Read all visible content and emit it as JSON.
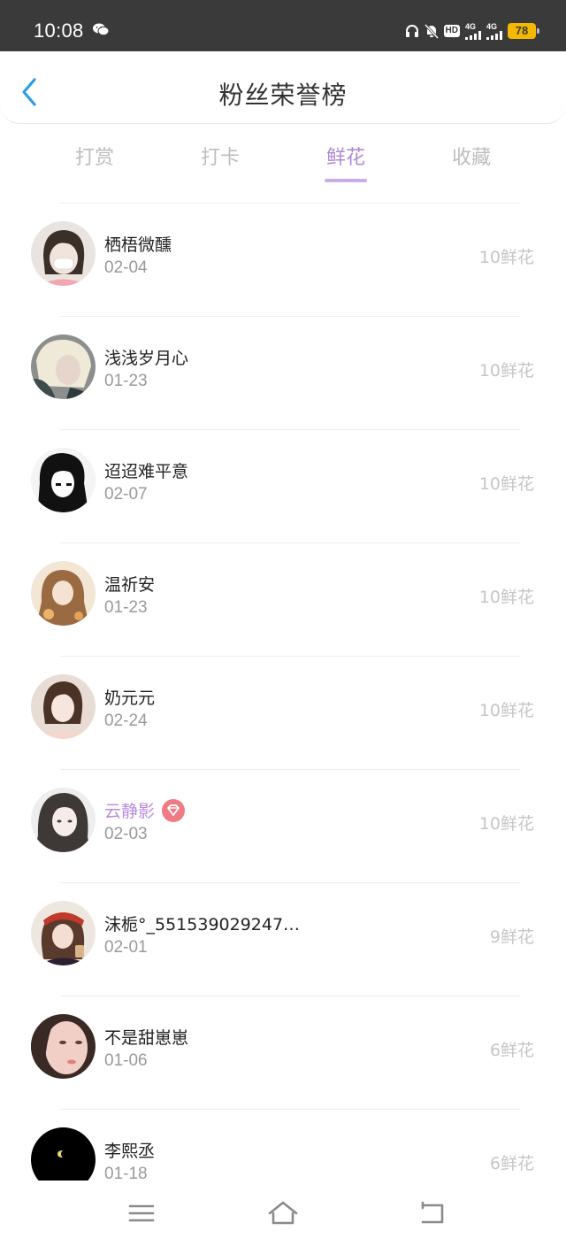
{
  "status_bar": {
    "time": "10:08",
    "hd_label": "HD",
    "network_1": "4G",
    "network_2": "4G",
    "battery": "78",
    "icons": [
      "wechat-icon",
      "headphones-icon",
      "mute-bell-icon",
      "hd-icon",
      "signal-icon",
      "signal-icon",
      "battery-icon"
    ]
  },
  "header": {
    "title": "粉丝荣誉榜",
    "back_icon": "chevron-left-icon"
  },
  "tabs": [
    {
      "label": "打赏",
      "active": false
    },
    {
      "label": "打卡",
      "active": false
    },
    {
      "label": "鲜花",
      "active": true
    },
    {
      "label": "收藏",
      "active": false
    }
  ],
  "colors": {
    "accent": "#b08ad6",
    "back_icon": "#2d9ce6",
    "status_bar": "#3a3a3a",
    "battery": "#f5b800",
    "vip_badge": "#f07a86"
  },
  "fans": [
    {
      "name": "栖梧微醺",
      "date": "02-04",
      "amount": "10鲜花",
      "vip": false
    },
    {
      "name": "浅浅岁月心",
      "date": "01-23",
      "amount": "10鲜花",
      "vip": false
    },
    {
      "name": "迢迢难平意",
      "date": "02-07",
      "amount": "10鲜花",
      "vip": false
    },
    {
      "name": "温祈安",
      "date": "01-23",
      "amount": "10鲜花",
      "vip": false
    },
    {
      "name": "奶元元",
      "date": "02-24",
      "amount": "10鲜花",
      "vip": false
    },
    {
      "name": "云静影",
      "date": "02-03",
      "amount": "10鲜花",
      "vip": true
    },
    {
      "name": "沫栀°_551539029247…",
      "date": "02-01",
      "amount": "9鲜花",
      "vip": false
    },
    {
      "name": "不是甜崽崽",
      "date": "01-06",
      "amount": "6鲜花",
      "vip": false
    },
    {
      "name": "李熙丞",
      "date": "01-18",
      "amount": "6鲜花",
      "vip": false
    }
  ],
  "nav_bar": {
    "icons": [
      "menu-icon",
      "home-icon",
      "back-icon"
    ]
  }
}
